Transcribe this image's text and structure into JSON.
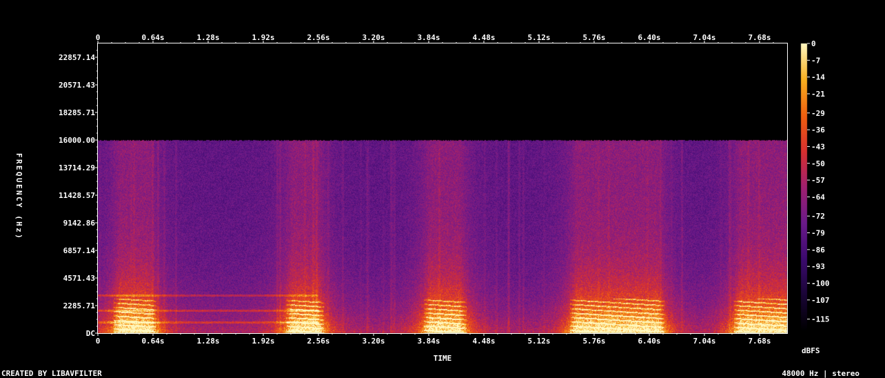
{
  "chart_data": {
    "type": "heatmap",
    "title": "",
    "xlabel": "TIME",
    "ylabel": "FREQUENCY (Hz)",
    "colorbar_label": "dBFS",
    "x_ticks": [
      "0",
      "0.64s",
      "1.28s",
      "1.92s",
      "2.56s",
      "3.20s",
      "3.84s",
      "4.48s",
      "5.12s",
      "5.76s",
      "6.40s",
      "7.04s",
      "7.68s"
    ],
    "x_tick_values": [
      0,
      0.64,
      1.28,
      1.92,
      2.56,
      3.2,
      3.84,
      4.48,
      5.12,
      5.76,
      6.4,
      7.04,
      7.68
    ],
    "y_ticks": [
      "DC",
      "2285.71",
      "4571.43",
      "6857.14",
      "9142.86",
      "11428.57",
      "13714.29",
      "16000.00",
      "18285.71",
      "20571.43",
      "22857.14"
    ],
    "y_tick_values": [
      0,
      2285.71,
      4571.43,
      6857.14,
      9142.86,
      11428.57,
      13714.29,
      16000.0,
      18285.71,
      20571.43,
      22857.14
    ],
    "colorbar_ticks": [
      "0",
      "-7",
      "-14",
      "-21",
      "-29",
      "-36",
      "-43",
      "-50",
      "-57",
      "-64",
      "-72",
      "-79",
      "-86",
      "-93",
      "-100",
      "-107",
      "-115"
    ],
    "colorbar_values": [
      0,
      -7,
      -14,
      -21,
      -29,
      -36,
      -43,
      -50,
      -57,
      -64,
      -72,
      -79,
      -86,
      -93,
      -100,
      -107,
      -115
    ],
    "xlim": [
      0,
      8.0
    ],
    "ylim": [
      0,
      24000
    ],
    "zlim": [
      -120,
      0
    ],
    "content_cutoff_hz": 16000,
    "colormap": [
      "#000000",
      "#1a0536",
      "#3c0a6e",
      "#6a1a8a",
      "#a02070",
      "#d83030",
      "#f06010",
      "#f8b020",
      "#fff8c0"
    ],
    "speech_bursts_s": [
      [
        0.25,
        0.6
      ],
      [
        2.25,
        2.55
      ],
      [
        3.85,
        4.2
      ],
      [
        5.55,
        6.5
      ],
      [
        7.45,
        8.0
      ]
    ]
  },
  "footer": {
    "left_text": "CREATED BY LIBAVFILTER",
    "right_text": "48000 Hz | stereo"
  }
}
